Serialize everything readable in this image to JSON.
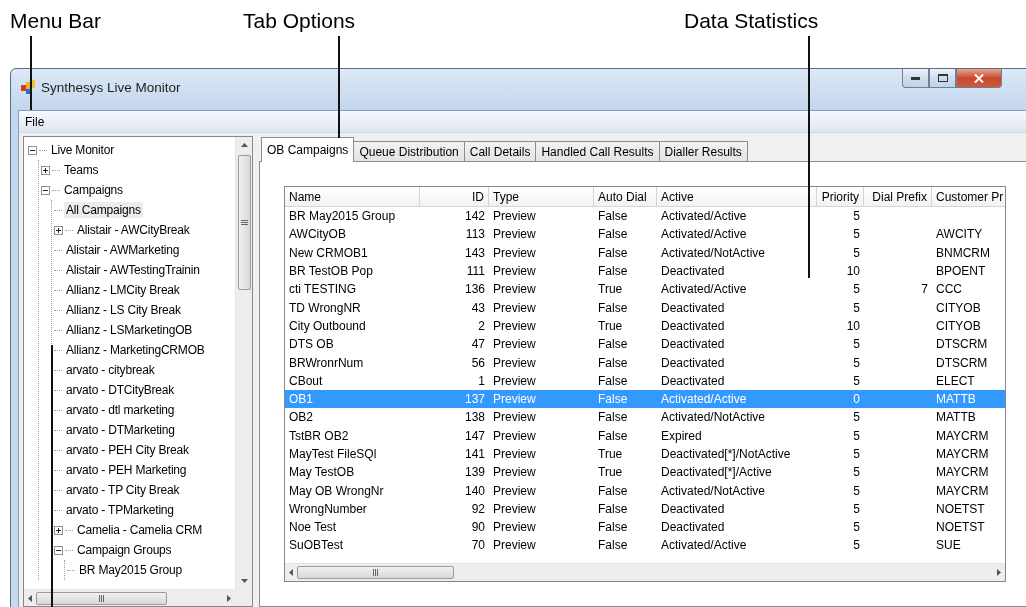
{
  "annotations": [
    {
      "label": "Menu Bar"
    },
    {
      "label": "Tab Options"
    },
    {
      "label": "Data Statistics"
    }
  ],
  "window": {
    "title": "Synthesys Live Monitor"
  },
  "menu": [
    "File"
  ],
  "tree": [
    {
      "label": "Live Monitor",
      "kind": "folder",
      "expanded": true,
      "selected": false,
      "children": [
        {
          "label": "Teams",
          "kind": "folder",
          "expanded": false,
          "selected": false
        },
        {
          "label": "Campaigns",
          "kind": "folder",
          "expanded": true,
          "selected": false,
          "children": [
            {
              "label": "All Campaigns",
              "kind": "leaf",
              "selected": true
            },
            {
              "label": "Alistair - AWCityBreak",
              "kind": "folder",
              "expanded": false,
              "selected": false
            },
            {
              "label": "Alistair - AWMarketing",
              "kind": "leaf",
              "selected": false
            },
            {
              "label": "Alistair - AWTestingTrainin",
              "kind": "leaf",
              "selected": false
            },
            {
              "label": "Allianz - LMCity Break",
              "kind": "leaf",
              "selected": false
            },
            {
              "label": "Allianz - LS City Break",
              "kind": "leaf",
              "selected": false
            },
            {
              "label": "Allianz - LSMarketingOB",
              "kind": "leaf",
              "selected": false
            },
            {
              "label": "Allianz - MarketingCRMOB",
              "kind": "leaf",
              "selected": false
            },
            {
              "label": "arvato - citybreak",
              "kind": "leaf",
              "selected": false
            },
            {
              "label": "arvato - DTCityBreak",
              "kind": "leaf",
              "selected": false
            },
            {
              "label": "arvato - dtl marketing",
              "kind": "leaf",
              "selected": false
            },
            {
              "label": "arvato - DTMarketing",
              "kind": "leaf",
              "selected": false
            },
            {
              "label": "arvato - PEH City Break",
              "kind": "leaf",
              "selected": false
            },
            {
              "label": "arvato - PEH Marketing",
              "kind": "leaf",
              "selected": false
            },
            {
              "label": "arvato - TP City Break",
              "kind": "leaf",
              "selected": false
            },
            {
              "label": "arvato - TPMarketing",
              "kind": "leaf",
              "selected": false
            },
            {
              "label": "Camelia - Camelia CRM",
              "kind": "folder",
              "expanded": false,
              "selected": false
            },
            {
              "label": "Campaign Groups",
              "kind": "folder",
              "expanded": true,
              "selected": false,
              "children": [
                {
                  "label": "BR May2015 Group",
                  "kind": "leaf",
                  "selected": false
                }
              ]
            }
          ]
        }
      ]
    }
  ],
  "tabs": [
    {
      "label": "OB Campaigns",
      "selected": true
    },
    {
      "label": "Queue Distribution",
      "selected": false
    },
    {
      "label": "Call Details",
      "selected": false
    },
    {
      "label": "Handled Call Results",
      "selected": false
    },
    {
      "label": "Dialler Results",
      "selected": false
    }
  ],
  "table": {
    "columns": [
      "Name",
      "ID",
      "Type",
      "Auto Dial",
      "Active",
      "Priority",
      "Dial Prefix",
      "Customer Pr"
    ],
    "rows": [
      {
        "selected": false,
        "name": "BR May2015 Group",
        "id": "142",
        "type": "Preview",
        "auto_dial": "False",
        "active": "Activated/Active",
        "priority": "5"
      },
      {
        "selected": false,
        "name": "AWCityOB",
        "id": "113",
        "type": "Preview",
        "auto_dial": "False",
        "active": "Activated/Active",
        "priority": "5",
        "customer": "AWCITY"
      },
      {
        "selected": false,
        "name": "New CRMOB1",
        "id": "143",
        "type": "Preview",
        "auto_dial": "False",
        "active": "Activated/NotActive",
        "priority": "5",
        "customer": "BNMCRM"
      },
      {
        "selected": false,
        "name": "BR TestOB Pop",
        "id": "111",
        "type": "Preview",
        "auto_dial": "False",
        "active": "Deactivated",
        "priority": "10",
        "customer": "BPOENT"
      },
      {
        "selected": false,
        "name": "cti TESTING",
        "id": "136",
        "type": "Preview",
        "auto_dial": "True",
        "active": "Activated/Active",
        "priority": "5",
        "dial_prefix": "7",
        "customer": "CCC"
      },
      {
        "selected": false,
        "name": "TD WrongNR",
        "id": "43",
        "type": "Preview",
        "auto_dial": "False",
        "active": "Deactivated",
        "priority": "5",
        "customer": "CITYOB"
      },
      {
        "selected": false,
        "name": "City Outbound",
        "id": "2",
        "type": "Preview",
        "auto_dial": "True",
        "active": "Deactivated",
        "priority": "10",
        "customer": "CITYOB"
      },
      {
        "selected": false,
        "name": "DTS OB",
        "id": "47",
        "type": "Preview",
        "auto_dial": "False",
        "active": "Deactivated",
        "priority": "5",
        "customer": "DTSCRM"
      },
      {
        "selected": false,
        "name": "BRWronrNum",
        "id": "56",
        "type": "Preview",
        "auto_dial": "False",
        "active": "Deactivated",
        "priority": "5",
        "customer": "DTSCRM"
      },
      {
        "selected": false,
        "name": "CBout",
        "id": "1",
        "type": "Preview",
        "auto_dial": "False",
        "active": "Deactivated",
        "priority": "5",
        "customer": "ELECT"
      },
      {
        "selected": true,
        "name": "OB1",
        "id": "137",
        "type": "Preview",
        "auto_dial": "False",
        "active": "Activated/Active",
        "priority": "0",
        "customer": "MATTB"
      },
      {
        "selected": false,
        "name": "OB2",
        "id": "138",
        "type": "Preview",
        "auto_dial": "False",
        "active": "Activated/NotActive",
        "priority": "5",
        "customer": "MATTB"
      },
      {
        "selected": false,
        "name": "TstBR OB2",
        "id": "147",
        "type": "Preview",
        "auto_dial": "False",
        "active": "Expired",
        "priority": "5",
        "customer": "MAYCRM"
      },
      {
        "selected": false,
        "name": "MayTest FileSQl",
        "id": "141",
        "type": "Preview",
        "auto_dial": "True",
        "active": "Deactivated[*]/NotActive",
        "priority": "5",
        "customer": "MAYCRM"
      },
      {
        "selected": false,
        "name": "May TestOB",
        "id": "139",
        "type": "Preview",
        "auto_dial": "True",
        "active": "Deactivated[*]/Active",
        "priority": "5",
        "customer": "MAYCRM"
      },
      {
        "selected": false,
        "name": "May OB WrongNr",
        "id": "140",
        "type": "Preview",
        "auto_dial": "False",
        "active": "Activated/NotActive",
        "priority": "5",
        "customer": "MAYCRM"
      },
      {
        "selected": false,
        "name": "WrongNumber",
        "id": "92",
        "type": "Preview",
        "auto_dial": "False",
        "active": "Deactivated",
        "priority": "5",
        "customer": "NOETST"
      },
      {
        "selected": false,
        "name": "Noe Test",
        "id": "90",
        "type": "Preview",
        "auto_dial": "False",
        "active": "Deactivated",
        "priority": "5",
        "customer": "NOETST"
      },
      {
        "selected": false,
        "name": "SuOBTest",
        "id": "70",
        "type": "Preview",
        "auto_dial": "False",
        "active": "Activated/Active",
        "priority": "5",
        "customer": "SUE"
      }
    ]
  }
}
